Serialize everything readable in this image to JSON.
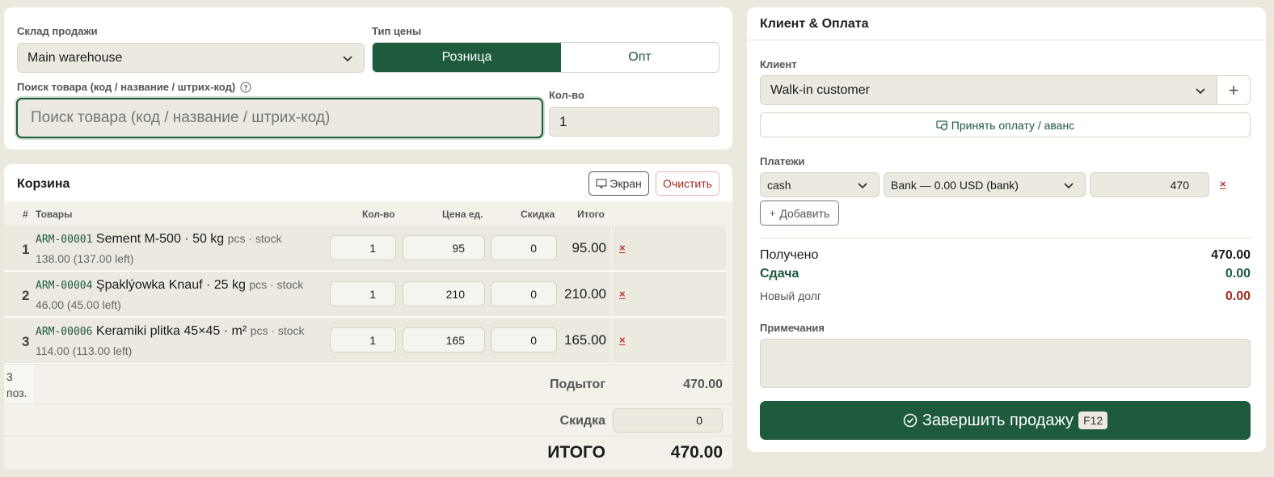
{
  "top": {
    "warehouse_label": "Склад продажи",
    "warehouse_value": "Main warehouse",
    "price_type_label": "Тип цены",
    "price_retail": "Розница",
    "price_wholesale": "Опт",
    "search_label": "Поиск товара (код / название / штрих-код)",
    "search_placeholder": "Поиск товара (код / название / штрих-код)",
    "qty_label": "Кол-во",
    "qty_value": "1"
  },
  "cart": {
    "title": "Корзина",
    "screen_button": "Экран",
    "clear_button": "Очистить",
    "headers": {
      "num": "#",
      "items": "Товары",
      "qty": "Кол-во",
      "price": "Цена ед.",
      "discount": "Скидка",
      "total": "Итого"
    },
    "rows": [
      {
        "num": "1",
        "code": "ARM-00001",
        "name": "Sement M-500 · 50 kg",
        "unit": "pcs · stock",
        "stock": "138.00 (137.00 left)",
        "qty": "1",
        "price": "95",
        "discount": "0",
        "total": "95.00",
        "del": "×"
      },
      {
        "num": "2",
        "code": "ARM-00004",
        "name": "Şpaklýowka Knauf · 25 kg",
        "unit": "pcs · stock",
        "stock": "46.00 (45.00 left)",
        "qty": "1",
        "price": "210",
        "discount": "0",
        "total": "210.00",
        "del": "×"
      },
      {
        "num": "3",
        "code": "ARM-00006",
        "name": "Keramiki plitka 45×45 · m²",
        "unit": "pcs · stock",
        "stock": "114.00 (113.00 left)",
        "qty": "1",
        "price": "165",
        "discount": "0",
        "total": "165.00",
        "del": "×"
      }
    ],
    "positions": "3 поз.",
    "subtotal_label": "Подытог",
    "subtotal_value": "470.00",
    "discount_label": "Скидка",
    "discount_value": "0",
    "grand_label": "ИТОГО",
    "grand_value": "470.00"
  },
  "client": {
    "title": "Клиент & Оплата",
    "client_label": "Клиент",
    "client_value": "Walk-in customer",
    "add_client": "+",
    "accept_payment": "Принять оплату / аванс",
    "payments_label": "Платежи",
    "payment_method": "cash",
    "payment_account": "Bank — 0.00 USD (bank)",
    "payment_amount": "470",
    "payment_remove": "×",
    "add_payment": "Добавить",
    "received_label": "Получено",
    "received_value": "470.00",
    "change_label": "Сдача",
    "change_value": "0.00",
    "debt_label": "Новый долг",
    "debt_value": "0.00",
    "notes_label": "Примечания",
    "complete_button": "Завершить продажу",
    "complete_shortcut": "F12"
  },
  "colors": {
    "accent": "#1e5a3c",
    "danger": "#a6281f",
    "background": "#ebe8dd",
    "field": "#ece9e0"
  }
}
